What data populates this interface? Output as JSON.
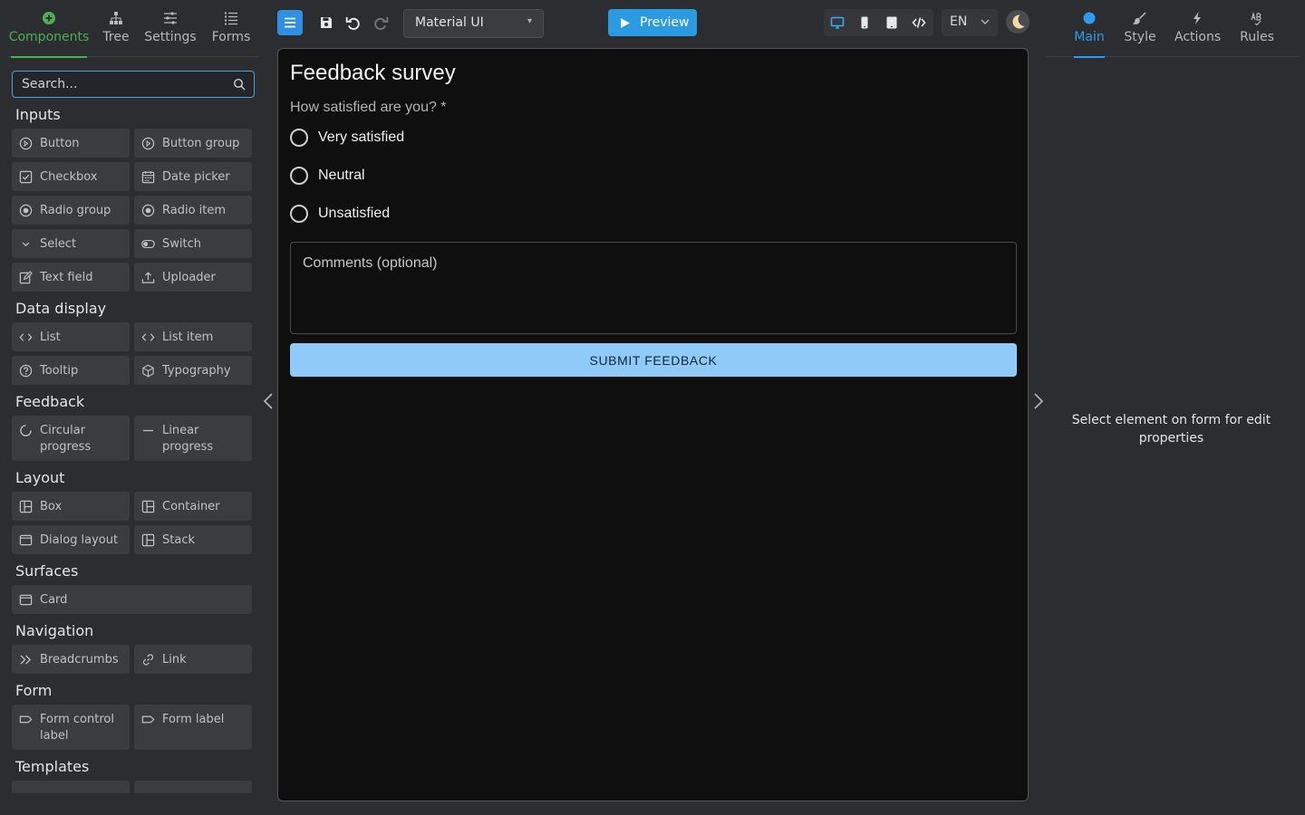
{
  "left_tabs": [
    {
      "label": "Components",
      "icon": "plus-circle-icon"
    },
    {
      "label": "Tree",
      "icon": "sitemap-icon"
    },
    {
      "label": "Settings",
      "icon": "sliders-icon"
    },
    {
      "label": "Forms",
      "icon": "list-icon"
    }
  ],
  "search": {
    "placeholder": "Search..."
  },
  "categories": [
    {
      "title": "Inputs",
      "items": [
        "Button",
        "Button group",
        "Checkbox",
        "Date picker",
        "Radio group",
        "Radio item",
        "Select",
        "Switch",
        "Text field",
        "Uploader"
      ]
    },
    {
      "title": "Data display",
      "items": [
        "List",
        "List item",
        "Tooltip",
        "Typography"
      ]
    },
    {
      "title": "Feedback",
      "items": [
        "Circular progress",
        "Linear progress"
      ]
    },
    {
      "title": "Layout",
      "items": [
        "Box",
        "Container",
        "Dialog layout",
        "Stack"
      ]
    },
    {
      "title": "Surfaces",
      "items": [
        "Card"
      ]
    },
    {
      "title": "Navigation",
      "items": [
        "Breadcrumbs",
        "Link"
      ]
    },
    {
      "title": "Form",
      "items": [
        "Form control label",
        "Form label"
      ]
    },
    {
      "title": "Templates",
      "items": []
    }
  ],
  "toolbar": {
    "theme_select": "Material UI",
    "preview_label": "Preview",
    "language": "EN"
  },
  "form": {
    "title": "Feedback survey",
    "question": "How satisfied are you? *",
    "options": [
      "Very satisfied",
      "Neutral",
      "Unsatisfied"
    ],
    "comments_placeholder": "Comments (optional)",
    "submit_label": "SUBMIT FEEDBACK"
  },
  "right_tabs": [
    {
      "label": "Main",
      "icon": "circle-icon"
    },
    {
      "label": "Style",
      "icon": "brush-icon"
    },
    {
      "label": "Actions",
      "icon": "lightning-icon"
    },
    {
      "label": "Rules",
      "icon": "rules-icon"
    }
  ],
  "properties_hint": "Select element on form for edit properties",
  "colors": {
    "components_accent": "#4caf50",
    "primary_accent": "#2d9cf0",
    "submit_button": "#90caf9"
  }
}
